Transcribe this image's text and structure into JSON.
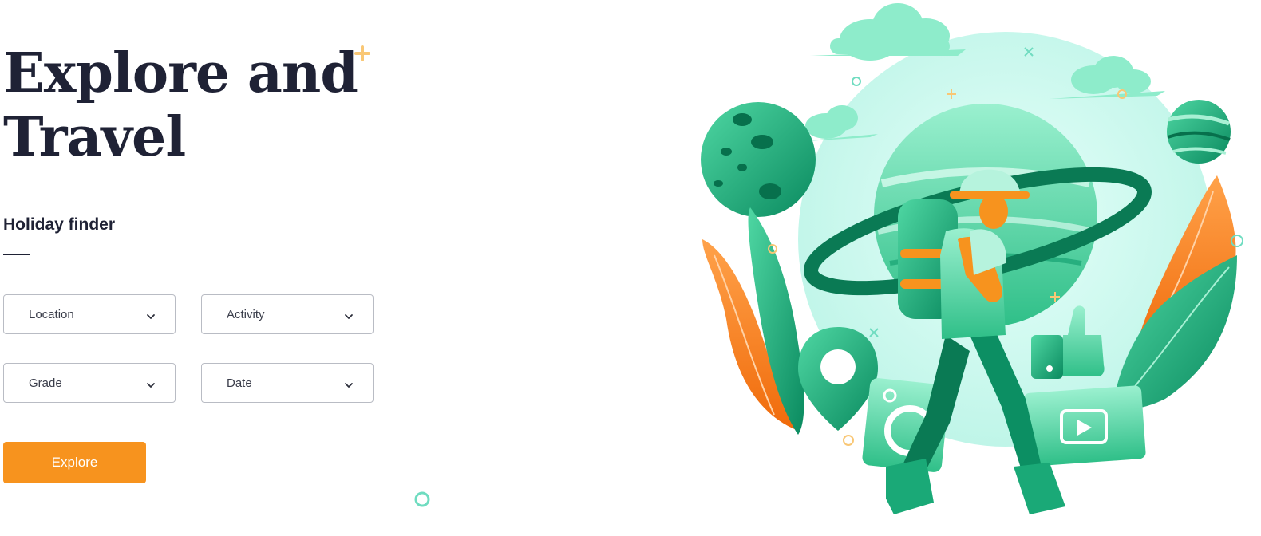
{
  "hero": {
    "title_line1": "Explore and",
    "title_line2": "Travel"
  },
  "finder": {
    "heading": "Holiday finder",
    "selects": {
      "location": "Location",
      "activity": "Activity",
      "grade": "Grade",
      "date": "Date"
    },
    "submit_label": "Explore"
  },
  "icons": {
    "dropdown": "chevron-down-icon",
    "deco_plus": "plus-icon",
    "deco_ring": "ring-icon"
  },
  "colors": {
    "accent": "#f7931e",
    "heading": "#1f2235",
    "green_dark": "#0c8f63",
    "green_light": "#5ee0b0",
    "sky": "#c9f6ec"
  }
}
